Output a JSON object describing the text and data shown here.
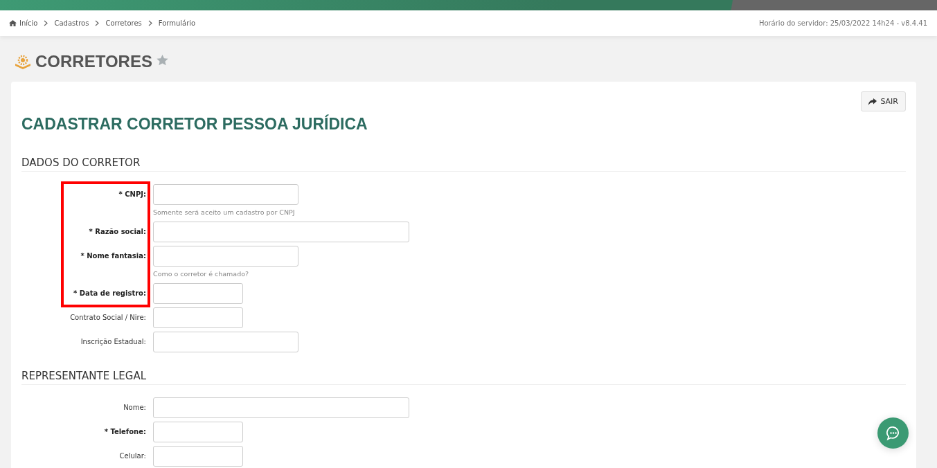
{
  "breadcrumb": [
    "Início",
    "Cadastros",
    "Corretores",
    "Formulário"
  ],
  "server_info": "Horário do servidor: 25/03/2022 14h24 - v8.4.41",
  "page_title": "CORRETORES",
  "favorite": false,
  "exit_button": "SAIR",
  "form_title": "CADASTRAR CORRETOR PESSOA JURÍDICA",
  "sections": [
    {
      "title": "DADOS DO CORRETOR",
      "fields": [
        {
          "label": "* CNPJ:",
          "required": true,
          "kind": "medium",
          "hint": "Somente será aceito um cadastro por CNPJ",
          "highlighted": true
        },
        {
          "label": "* Razão social:",
          "required": true,
          "kind": "long",
          "highlighted": true
        },
        {
          "label": "* Nome fantasia:",
          "required": true,
          "kind": "medium",
          "hint": "Como o corretor é chamado?",
          "highlighted": true
        },
        {
          "label": "* Data de registro:",
          "required": true,
          "kind": "short",
          "highlighted": true
        },
        {
          "label": "Contrato Social / Nire:",
          "required": false,
          "kind": "short",
          "highlighted": false
        },
        {
          "label": "Inscrição Estadual:",
          "required": false,
          "kind": "medium",
          "highlighted": false
        }
      ]
    },
    {
      "title": "REPRESENTANTE LEGAL",
      "fields": [
        {
          "label": "Nome:",
          "required": false,
          "kind": "long",
          "highlighted": false
        },
        {
          "label": "* Telefone:",
          "required": true,
          "kind": "short",
          "highlighted": false
        },
        {
          "label": "Celular:",
          "required": false,
          "kind": "short",
          "highlighted": false
        }
      ]
    }
  ]
}
